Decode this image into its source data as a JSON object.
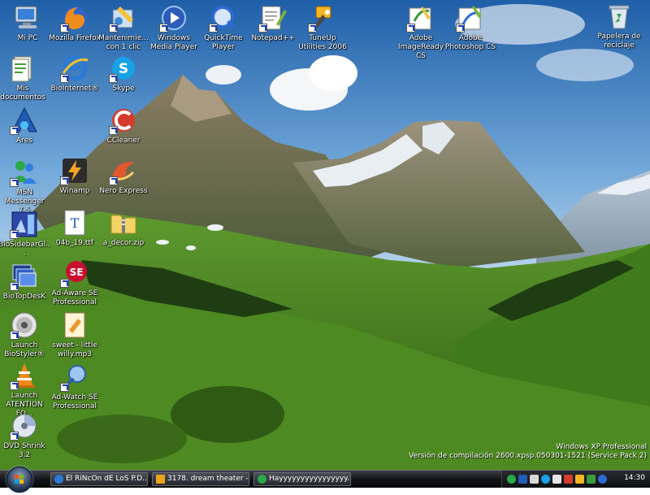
{
  "desktop": {
    "icons": [
      {
        "label": "Mi PC",
        "icon": "computer-icon",
        "shortcut": false
      },
      {
        "label": "Mis documentos",
        "icon": "documents-folder-icon",
        "shortcut": false
      },
      {
        "label": "Ares",
        "icon": "ares-icon",
        "shortcut": true
      },
      {
        "label": "MSN Messenger 7.5",
        "icon": "msn-messenger-icon",
        "shortcut": true
      },
      {
        "label": "BioSidebarGl...",
        "icon": "biosidebar-icon",
        "shortcut": true
      },
      {
        "label": "BioTopDesK",
        "icon": "biotopdesk-icon",
        "shortcut": true
      },
      {
        "label": "Launch BioStyler®",
        "icon": "biostyler-icon",
        "shortcut": true
      },
      {
        "label": "Launch ATENTION FO...",
        "icon": "vlc-cone-icon",
        "shortcut": true
      },
      {
        "label": "DVD Shrink 3.2",
        "icon": "dvd-shrink-icon",
        "shortcut": true
      },
      {
        "label": "Mozilla Firefox",
        "icon": "firefox-icon",
        "shortcut": true
      },
      {
        "label": "BioInternet®",
        "icon": "internet-explorer-icon",
        "shortcut": true
      },
      {
        "label": "Winamp",
        "icon": "winamp-icon",
        "shortcut": true
      },
      {
        "label": "04b_19.ttf",
        "icon": "font-file-icon",
        "shortcut": false
      },
      {
        "label": "Ad-Aware SE Professional",
        "icon": "ad-aware-icon",
        "shortcut": true
      },
      {
        "label": "sweet - little willy.mp3",
        "icon": "mp3-file-icon",
        "shortcut": false
      },
      {
        "label": "Ad-Watch SE Professional",
        "icon": "ad-watch-icon",
        "shortcut": true
      },
      {
        "label": "Mantenimie... con 1 clic",
        "icon": "maintenance-icon",
        "shortcut": true
      },
      {
        "label": "Skype",
        "icon": "skype-icon",
        "shortcut": true
      },
      {
        "label": "CCleaner",
        "icon": "ccleaner-icon",
        "shortcut": true
      },
      {
        "label": "Nero Express",
        "icon": "nero-icon",
        "shortcut": true
      },
      {
        "label": "a_decor.zip",
        "icon": "zip-folder-icon",
        "shortcut": false
      },
      {
        "label": "Windows Media Player",
        "icon": "media-player-icon",
        "shortcut": true
      },
      {
        "label": "QuickTime Player",
        "icon": "quicktime-icon",
        "shortcut": true
      },
      {
        "label": "Notepad++",
        "icon": "notepad-icon",
        "shortcut": true
      },
      {
        "label": "TuneUp Utilities 2006",
        "icon": "tuneup-icon",
        "shortcut": true
      },
      {
        "label": "Adobe ImageReady CS",
        "icon": "imageready-icon",
        "shortcut": true
      },
      {
        "label": "Adobe Photoshop CS",
        "icon": "photoshop-icon",
        "shortcut": true
      },
      {
        "label": "Papelera de reciclaje",
        "icon": "recycle-bin-icon",
        "shortcut": false
      }
    ]
  },
  "watermark": {
    "line1": "Windows XP Professional",
    "line2": "Versión de compilación 2600.xpsp.050301-1521 (Service Pack 2)"
  },
  "taskbar": {
    "tasks": [
      {
        "label": "El RiNcOn dE LoS P.D....",
        "icon": "internet-explorer-icon",
        "color": "#2b7ad6"
      },
      {
        "label": "3178. dream theater - ...",
        "icon": "winamp-icon",
        "color": "#e8a317"
      },
      {
        "label": "Hayyyyyyyyyyyyyyyy...",
        "icon": "msn-messenger-icon",
        "color": "#2aa84a"
      }
    ],
    "tray_icons": [
      "messenger-tray-icon",
      "ares-tray-icon",
      "network-tray-icon",
      "skype-tray-icon",
      "volume-tray-icon",
      "security-tray-icon",
      "update-tray-icon",
      "antivirus-tray-icon",
      "quicktime-tray-icon"
    ],
    "clock": "14:30"
  }
}
